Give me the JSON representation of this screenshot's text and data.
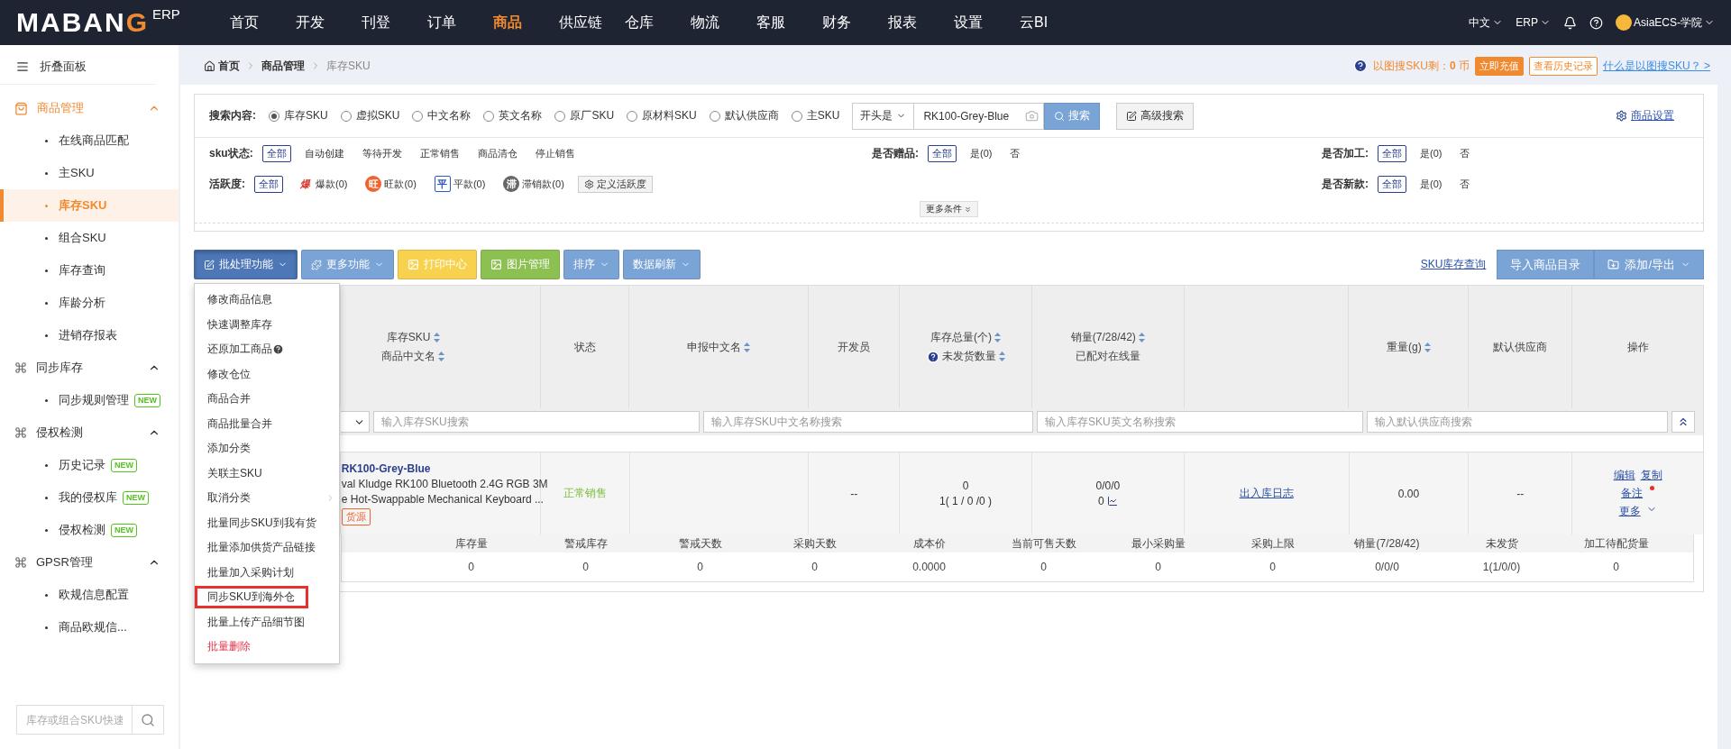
{
  "header": {
    "logo": {
      "text": "MABAN",
      "mark": "G",
      "suffix": "ERP"
    },
    "nav": [
      {
        "label": "首页",
        "selected": false
      },
      {
        "label": "开发",
        "selected": false
      },
      {
        "label": "刊登",
        "selected": false
      },
      {
        "label": "订单",
        "selected": false
      },
      {
        "label": "商品",
        "selected": true
      },
      {
        "label": "供应链",
        "selected": false
      },
      {
        "label": "仓库",
        "selected": false
      },
      {
        "label": "物流",
        "selected": false
      },
      {
        "label": "客服",
        "selected": false
      },
      {
        "label": "财务",
        "selected": false
      },
      {
        "label": "报表",
        "selected": false
      },
      {
        "label": "设置",
        "selected": false
      },
      {
        "label": "云BI",
        "selected": false
      }
    ],
    "language": "中文",
    "system": "ERP",
    "user": "AsiaECS-学院"
  },
  "sidebar": {
    "collapse_label": "折叠面板",
    "groups": [
      {
        "label": "商品管理",
        "kind": "bag",
        "active": true,
        "expanded": true,
        "children": [
          {
            "label": "在线商品匹配",
            "selected": false
          },
          {
            "label": "主SKU",
            "selected": false
          },
          {
            "label": "库存SKU",
            "selected": true
          },
          {
            "label": "组合SKU",
            "selected": false
          },
          {
            "label": "库存查询",
            "selected": false
          },
          {
            "label": "库龄分析",
            "selected": false
          },
          {
            "label": "进销存报表",
            "selected": false
          }
        ]
      },
      {
        "label": "同步库存",
        "kind": "command",
        "active": false,
        "expanded": true,
        "children": [
          {
            "label": "同步规则管理",
            "selected": false,
            "badge": "NEW"
          }
        ]
      },
      {
        "label": "侵权检测",
        "kind": "command",
        "active": false,
        "expanded": true,
        "children": [
          {
            "label": "历史记录",
            "selected": false,
            "badge": "NEW"
          },
          {
            "label": "我的侵权库",
            "selected": false,
            "badge": "NEW"
          },
          {
            "label": "侵权检测",
            "selected": false,
            "badge": "NEW"
          }
        ]
      },
      {
        "label": "GPSR管理",
        "kind": "command",
        "active": false,
        "expanded": true,
        "children": [
          {
            "label": "欧规信息配置",
            "selected": false
          },
          {
            "label": "商品欧规信...",
            "selected": false
          }
        ]
      }
    ],
    "search": {
      "placeholder": "库存或组合SKU快速"
    }
  },
  "breadcrumb": [
    "首页",
    "商品管理",
    "库存SKU"
  ],
  "image_search": {
    "balance": "以图搜SKU剩：**0** 币",
    "recharge_button": "立即充值",
    "history_button": "查看历史记录",
    "help_link": "什么是以图搜SKU？ >"
  },
  "filters": {
    "search_label": "搜索内容:",
    "search_options": [
      {
        "label": "库存SKU",
        "selected": true
      },
      {
        "label": "虚拟SKU",
        "selected": false
      },
      {
        "label": "中文名称",
        "selected": false
      },
      {
        "label": "英文名称",
        "selected": false
      },
      {
        "label": "原厂SKU",
        "selected": false
      },
      {
        "label": "原材料SKU",
        "selected": false
      },
      {
        "label": "默认供应商",
        "selected": false
      },
      {
        "label": "主SKU",
        "selected": false
      }
    ],
    "match_mode": "开头是",
    "value": "RK100-Grey-Blue",
    "search_button": "搜索",
    "advanced_button": "高级搜索",
    "settings_link": "商品设置",
    "sku_status": {
      "label": "sku状态:",
      "options": [
        {
          "label": "全部",
          "selected": true
        },
        {
          "label": "自动创建",
          "selected": false
        },
        {
          "label": "等待开发",
          "selected": false
        },
        {
          "label": "正常销售",
          "selected": false
        },
        {
          "label": "商品清仓",
          "selected": false
        },
        {
          "label": "停止销售",
          "selected": false
        }
      ]
    },
    "gift": {
      "label": "是否赠品:",
      "options": [
        {
          "label": "全部",
          "selected": true
        },
        {
          "label": "是(0)",
          "selected": false
        },
        {
          "label": "否",
          "selected": false
        }
      ]
    },
    "processing": {
      "label": "是否加工:",
      "options": [
        {
          "label": "全部",
          "selected": true
        },
        {
          "label": "是(0)",
          "selected": false
        },
        {
          "label": "否",
          "selected": false
        }
      ]
    },
    "activity": {
      "label": "活跃度:",
      "options": [
        {
          "label": "全部",
          "selected": true,
          "kind": "plain"
        },
        {
          "label": "爆款(0)",
          "selected": false,
          "kind": "hot",
          "badge": "爆"
        },
        {
          "label": "旺款(0)",
          "selected": false,
          "kind": "popular",
          "badge": "旺"
        },
        {
          "label": "平款(0)",
          "selected": false,
          "kind": "flat",
          "badge": "平"
        },
        {
          "label": "滞销款(0)",
          "selected": false,
          "kind": "slow",
          "badge": "滞"
        }
      ],
      "define_button": "定义活跃度"
    },
    "new_item": {
      "label": "是否新款:",
      "options": [
        {
          "label": "全部",
          "selected": true
        },
        {
          "label": "是(0)",
          "selected": false
        },
        {
          "label": "否",
          "selected": false
        }
      ]
    },
    "more_conditions": "更多条件"
  },
  "toolbar": {
    "buttons": [
      {
        "label": "批处理功能",
        "kind": "batch",
        "dropdown": true,
        "open": true
      },
      {
        "label": "更多功能",
        "kind": "more",
        "dropdown": true,
        "open": false
      },
      {
        "label": "打印中心",
        "kind": "print",
        "dropdown": false,
        "open": false
      },
      {
        "label": "图片管理",
        "kind": "image",
        "dropdown": false,
        "open": false
      },
      {
        "label": "排序",
        "kind": "plain",
        "dropdown": true,
        "open": false
      },
      {
        "label": "数据刷新",
        "kind": "plain",
        "dropdown": true,
        "open": false
      }
    ],
    "sku_query_link": "SKU库存查询",
    "import_button": "导入商品目录",
    "export_button": "添加/导出"
  },
  "menu": [
    {
      "label": "修改商品信息",
      "kind": "plain"
    },
    {
      "label": "快速调整库存",
      "kind": "plain"
    },
    {
      "label": "还原加工商品",
      "kind": "help"
    },
    {
      "label": "修改仓位",
      "kind": "plain"
    },
    {
      "label": "商品合并",
      "kind": "plain"
    },
    {
      "label": "商品批量合并",
      "kind": "plain"
    },
    {
      "label": "添加分类",
      "kind": "plain"
    },
    {
      "label": "关联主SKU",
      "kind": "plain"
    },
    {
      "label": "取消分类",
      "kind": "submenu"
    },
    {
      "label": "批量同步SKU到我有货",
      "kind": "plain"
    },
    {
      "label": "批量添加供货产品链接",
      "kind": "plain"
    },
    {
      "label": "批量加入采购计划",
      "kind": "plain"
    },
    {
      "label": "同步SKU到海外仓",
      "kind": "marked"
    },
    {
      "label": "批量上传产品细节图",
      "kind": "plain"
    },
    {
      "label": "批量删除",
      "kind": "danger"
    }
  ],
  "table": {
    "columns": [
      {},
      {
        "lines": [
          {
            "text": "库存SKU",
            "sortable": true,
            "help": false
          },
          {
            "text": "商品中文名",
            "sortable": true,
            "help": false
          }
        ]
      },
      {
        "lines": [
          {
            "text": "状态",
            "sortable": false,
            "help": false
          }
        ]
      },
      {
        "lines": [
          {
            "text": "申报中文名",
            "sortable": true,
            "help": false
          }
        ]
      },
      {
        "lines": [
          {
            "text": "开发员",
            "sortable": false,
            "help": false
          }
        ]
      },
      {
        "lines": [
          {
            "text": "库存总量(个)",
            "sortable": true,
            "help": false
          },
          {
            "text": "未发货数量",
            "sortable": true,
            "help": true
          }
        ]
      },
      {
        "lines": [
          {
            "text": "销量(7/28/42)",
            "sortable": true,
            "help": false
          },
          {
            "text": "已配对在线量",
            "sortable": false,
            "help": false
          }
        ]
      },
      {},
      {
        "lines": [
          {
            "text": "重量(g)",
            "sortable": true,
            "help": false
          }
        ]
      },
      {
        "lines": [
          {
            "text": "默认供应商",
            "sortable": false,
            "help": false
          }
        ]
      },
      {
        "lines": [
          {
            "text": "操作",
            "sortable": false,
            "help": false
          }
        ]
      }
    ],
    "filter_inputs": [
      {
        "placeholder": "输入库存SKU搜索"
      },
      {
        "placeholder": "输入库存SKU中文名称搜索"
      },
      {
        "placeholder": "输入库存SKU英文名称搜索"
      },
      {
        "placeholder": "输入默认供应商搜索"
      }
    ],
    "rows": [
      {
        "sku": "RK100-Grey-Blue",
        "name_lines": [
          "val Kludge RK100 Bluetooth 2.4G RGB 3M",
          "e Hot-Swappable Mechanical Keyboard ..."
        ],
        "source_tag": "货源",
        "status": "正常销售",
        "developer": "--",
        "stock_total": "0",
        "unshipped": "1( 1 / 0 /0 )",
        "sales": "0/0/0",
        "paired": "0",
        "log_link": "出入库日志",
        "weight": "0.00",
        "supplier": "--",
        "actions": {
          "edit": "编辑",
          "copy": "复制",
          "note": "备注",
          "more": "更多"
        },
        "details": {
          "headers": [
            "库存量",
            "警戒库存",
            "警戒天数",
            "采购天数",
            "成本价",
            "当前可售天数",
            "最小采购量",
            "采购上限",
            "销量(7/28/42)",
            "未发货",
            "加工待配货量"
          ],
          "values": [
            "0",
            "0",
            "0",
            "0",
            "0.0000",
            "0",
            "0",
            "0",
            "0/0/0",
            "1(1/0/0)",
            "0"
          ]
        }
      }
    ]
  }
}
